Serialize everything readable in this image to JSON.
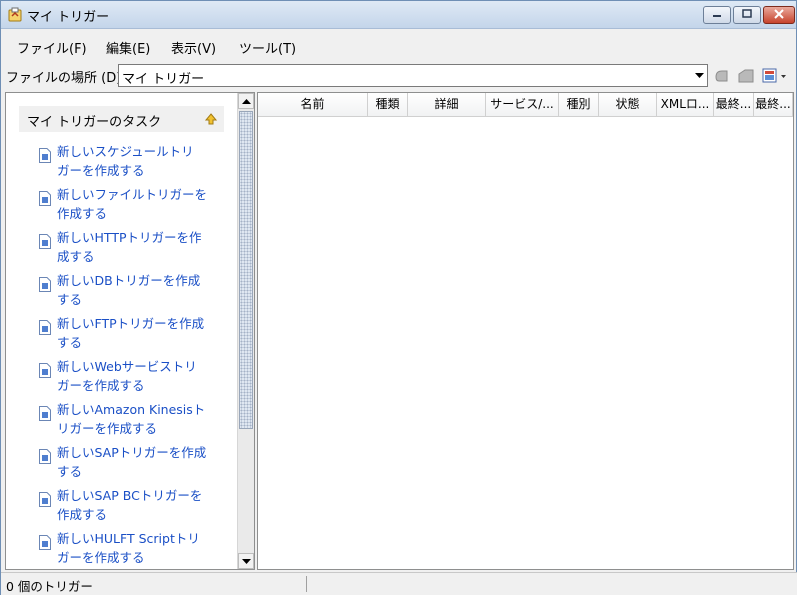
{
  "window": {
    "title": "マイ トリガー",
    "minimize_label": "minimize",
    "maximize_label": "maximize",
    "close_label": "close"
  },
  "menu": [
    {
      "label": "ファイル(F)"
    },
    {
      "label": "編集(E)"
    },
    {
      "label": "表示(V)"
    },
    {
      "label": "ツール(T)"
    }
  ],
  "address": {
    "label": "ファイルの場所 (D)",
    "value": "マイ トリガー"
  },
  "tasks": {
    "header": "マイ トリガーのタスク",
    "items": [
      {
        "line1": "新しいスケジュールトリ",
        "line2": "ガーを作成する"
      },
      {
        "line1": "新しいファイルトリガーを",
        "line2": "作成する"
      },
      {
        "line1": "新しいHTTPトリガーを作",
        "line2": "成する"
      },
      {
        "line1": "新しいDBトリガーを作成",
        "line2": "する"
      },
      {
        "line1": "新しいFTPトリガーを作成",
        "line2": "する"
      },
      {
        "line1": "新しいWebサービストリ",
        "line2": "ガーを作成する"
      },
      {
        "line1": "新しいAmazon Kinesisト",
        "line2": "リガーを作成する"
      },
      {
        "line1": "新しいSAPトリガーを作成",
        "line2": "する"
      },
      {
        "line1": "新しいSAP BCトリガーを",
        "line2": "作成する"
      },
      {
        "line1": "新しいHULFT Scriptトリ",
        "line2": "ガーを作成する"
      }
    ]
  },
  "columns": [
    {
      "label": "名前"
    },
    {
      "label": "種類"
    },
    {
      "label": "詳細"
    },
    {
      "label": "サービス/..."
    },
    {
      "label": "種別"
    },
    {
      "label": "状態"
    },
    {
      "label": "XMLロ..."
    },
    {
      "label": "最終..."
    },
    {
      "label": "最終..."
    }
  ],
  "status": {
    "text": "0 個のトリガー"
  },
  "icons": {
    "app": "trigger-app-icon",
    "collapse": "collapse-up-icon",
    "doc": "document-icon",
    "back": "back-icon",
    "up": "up-folder-icon",
    "view": "view-options-icon"
  },
  "colors": {
    "link": "#1a4fc6",
    "titlebar": "#c4d5ea",
    "close": "#c7432c"
  }
}
